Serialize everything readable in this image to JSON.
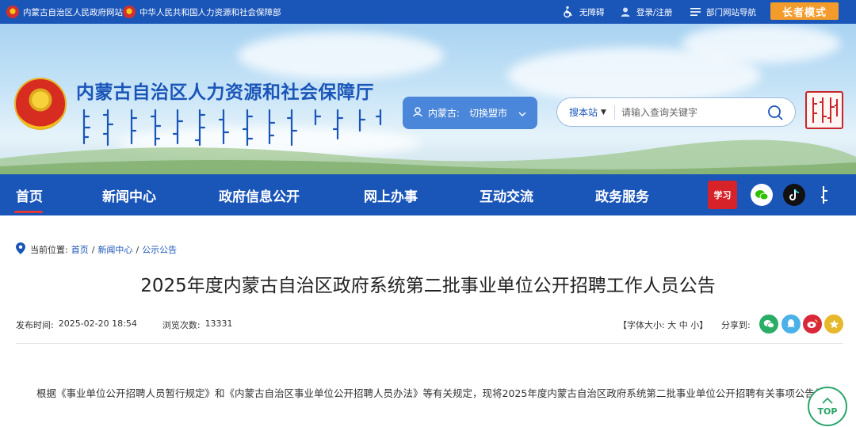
{
  "topbar": {
    "link1": "内蒙古自治区人民政府网站",
    "link2": "中华人民共和国人力资源和社会保障部",
    "accessibility": "无障碍",
    "login": "登录/注册",
    "dept_nav": "部门网站导航",
    "elder_mode": "长者模式"
  },
  "header": {
    "title": "内蒙古自治区人力资源和社会保障厅",
    "region_label": "内蒙古:",
    "region_switch": "切换盟市",
    "search_scope": "搜本站",
    "search_placeholder": "请输入查询关键字"
  },
  "nav": {
    "items": [
      "首页",
      "新闻中心",
      "政府信息公开",
      "网上办事",
      "互动交流",
      "政务服务"
    ],
    "social_xuexi": "学习"
  },
  "breadcrumb": {
    "label": "当前位置:",
    "home": "首页",
    "news": "新闻中心",
    "notices": "公示公告",
    "sep": "/"
  },
  "article": {
    "title": "2025年度内蒙古自治区政府系统第二批事业单位公开招聘工作人员公告",
    "publish_label": "发布时间:",
    "publish_time": "2025-02-20 18:54",
    "views_label": "浏览次数:",
    "views": "13331",
    "font_size": "【字体大小: 大 中 小】",
    "share_label": "分享到:",
    "paragraph": "根据《事业单位公开招聘人员暂行规定》和《内蒙古自治区事业单位公开招聘人员办法》等有关规定，现将2025年度内蒙古自治区政府系统第二批事业单位公开招聘有关事项公告如下。"
  },
  "top_button": "TOP",
  "colors": {
    "brand_blue": "#1a55b8",
    "elder_orange": "#f39c2b",
    "accent_red": "#e53935",
    "top_green": "#2aa46a"
  }
}
